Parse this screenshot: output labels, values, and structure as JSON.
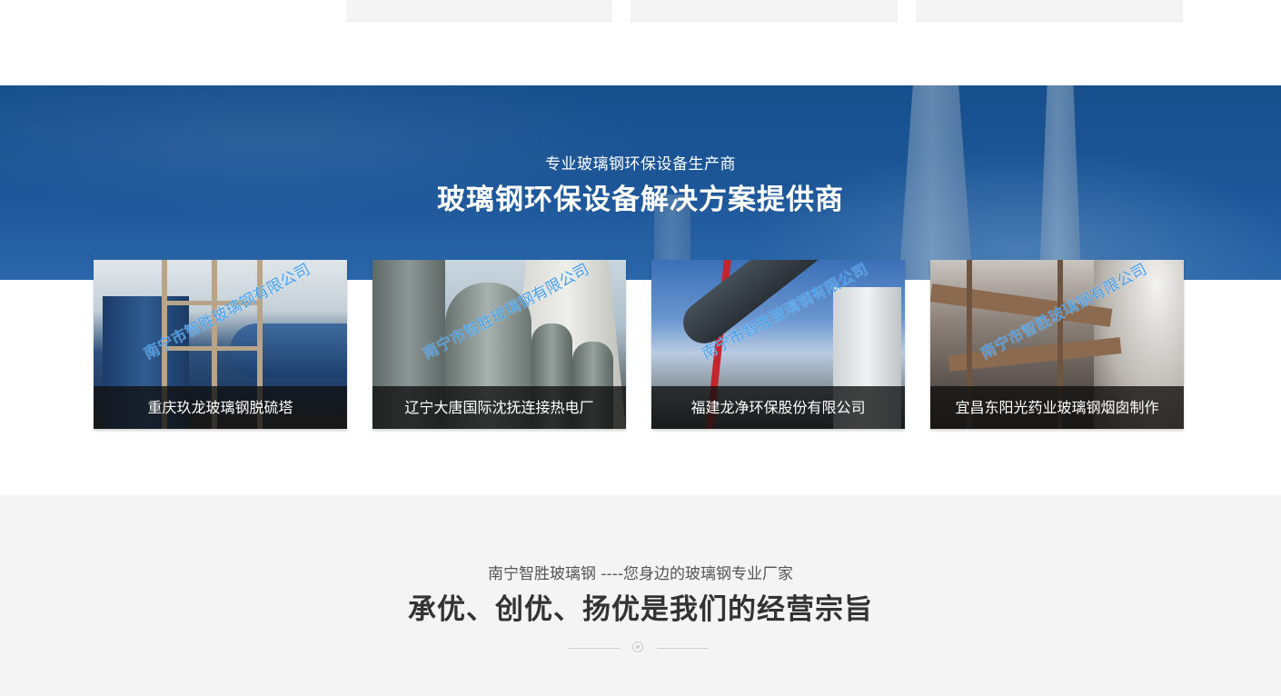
{
  "banner": {
    "subtitle": "专业玻璃钢环保设备生产商",
    "title": "玻璃钢环保设备解决方案提供商"
  },
  "cases": [
    {
      "caption": "重庆玖龙玻璃钢脱硫塔",
      "watermark": "南宁市智胜玻璃钢有限公司"
    },
    {
      "caption": "辽宁大唐国际沈抚连接热电厂",
      "watermark": "南宁市智胜玻璃钢有限公司"
    },
    {
      "caption": "福建龙净环保股份有限公司",
      "watermark": "南宁市智胜玻璃钢有限公司"
    },
    {
      "caption": "宜昌东阳光药业玻璃钢烟囱制作",
      "watermark": "南宁市智胜玻璃钢有限公司"
    }
  ],
  "about": {
    "subtitle": "南宁智胜玻璃钢 ----您身边的玻璃钢专业厂家",
    "title": "承优、创优、扬优是我们的经营宗旨"
  },
  "colors": {
    "banner_blue": "#1d5799",
    "watermark_blue": "#3a9bf0",
    "caption_bg": "#0f0f0f",
    "section_gray": "#f4f4f4"
  }
}
